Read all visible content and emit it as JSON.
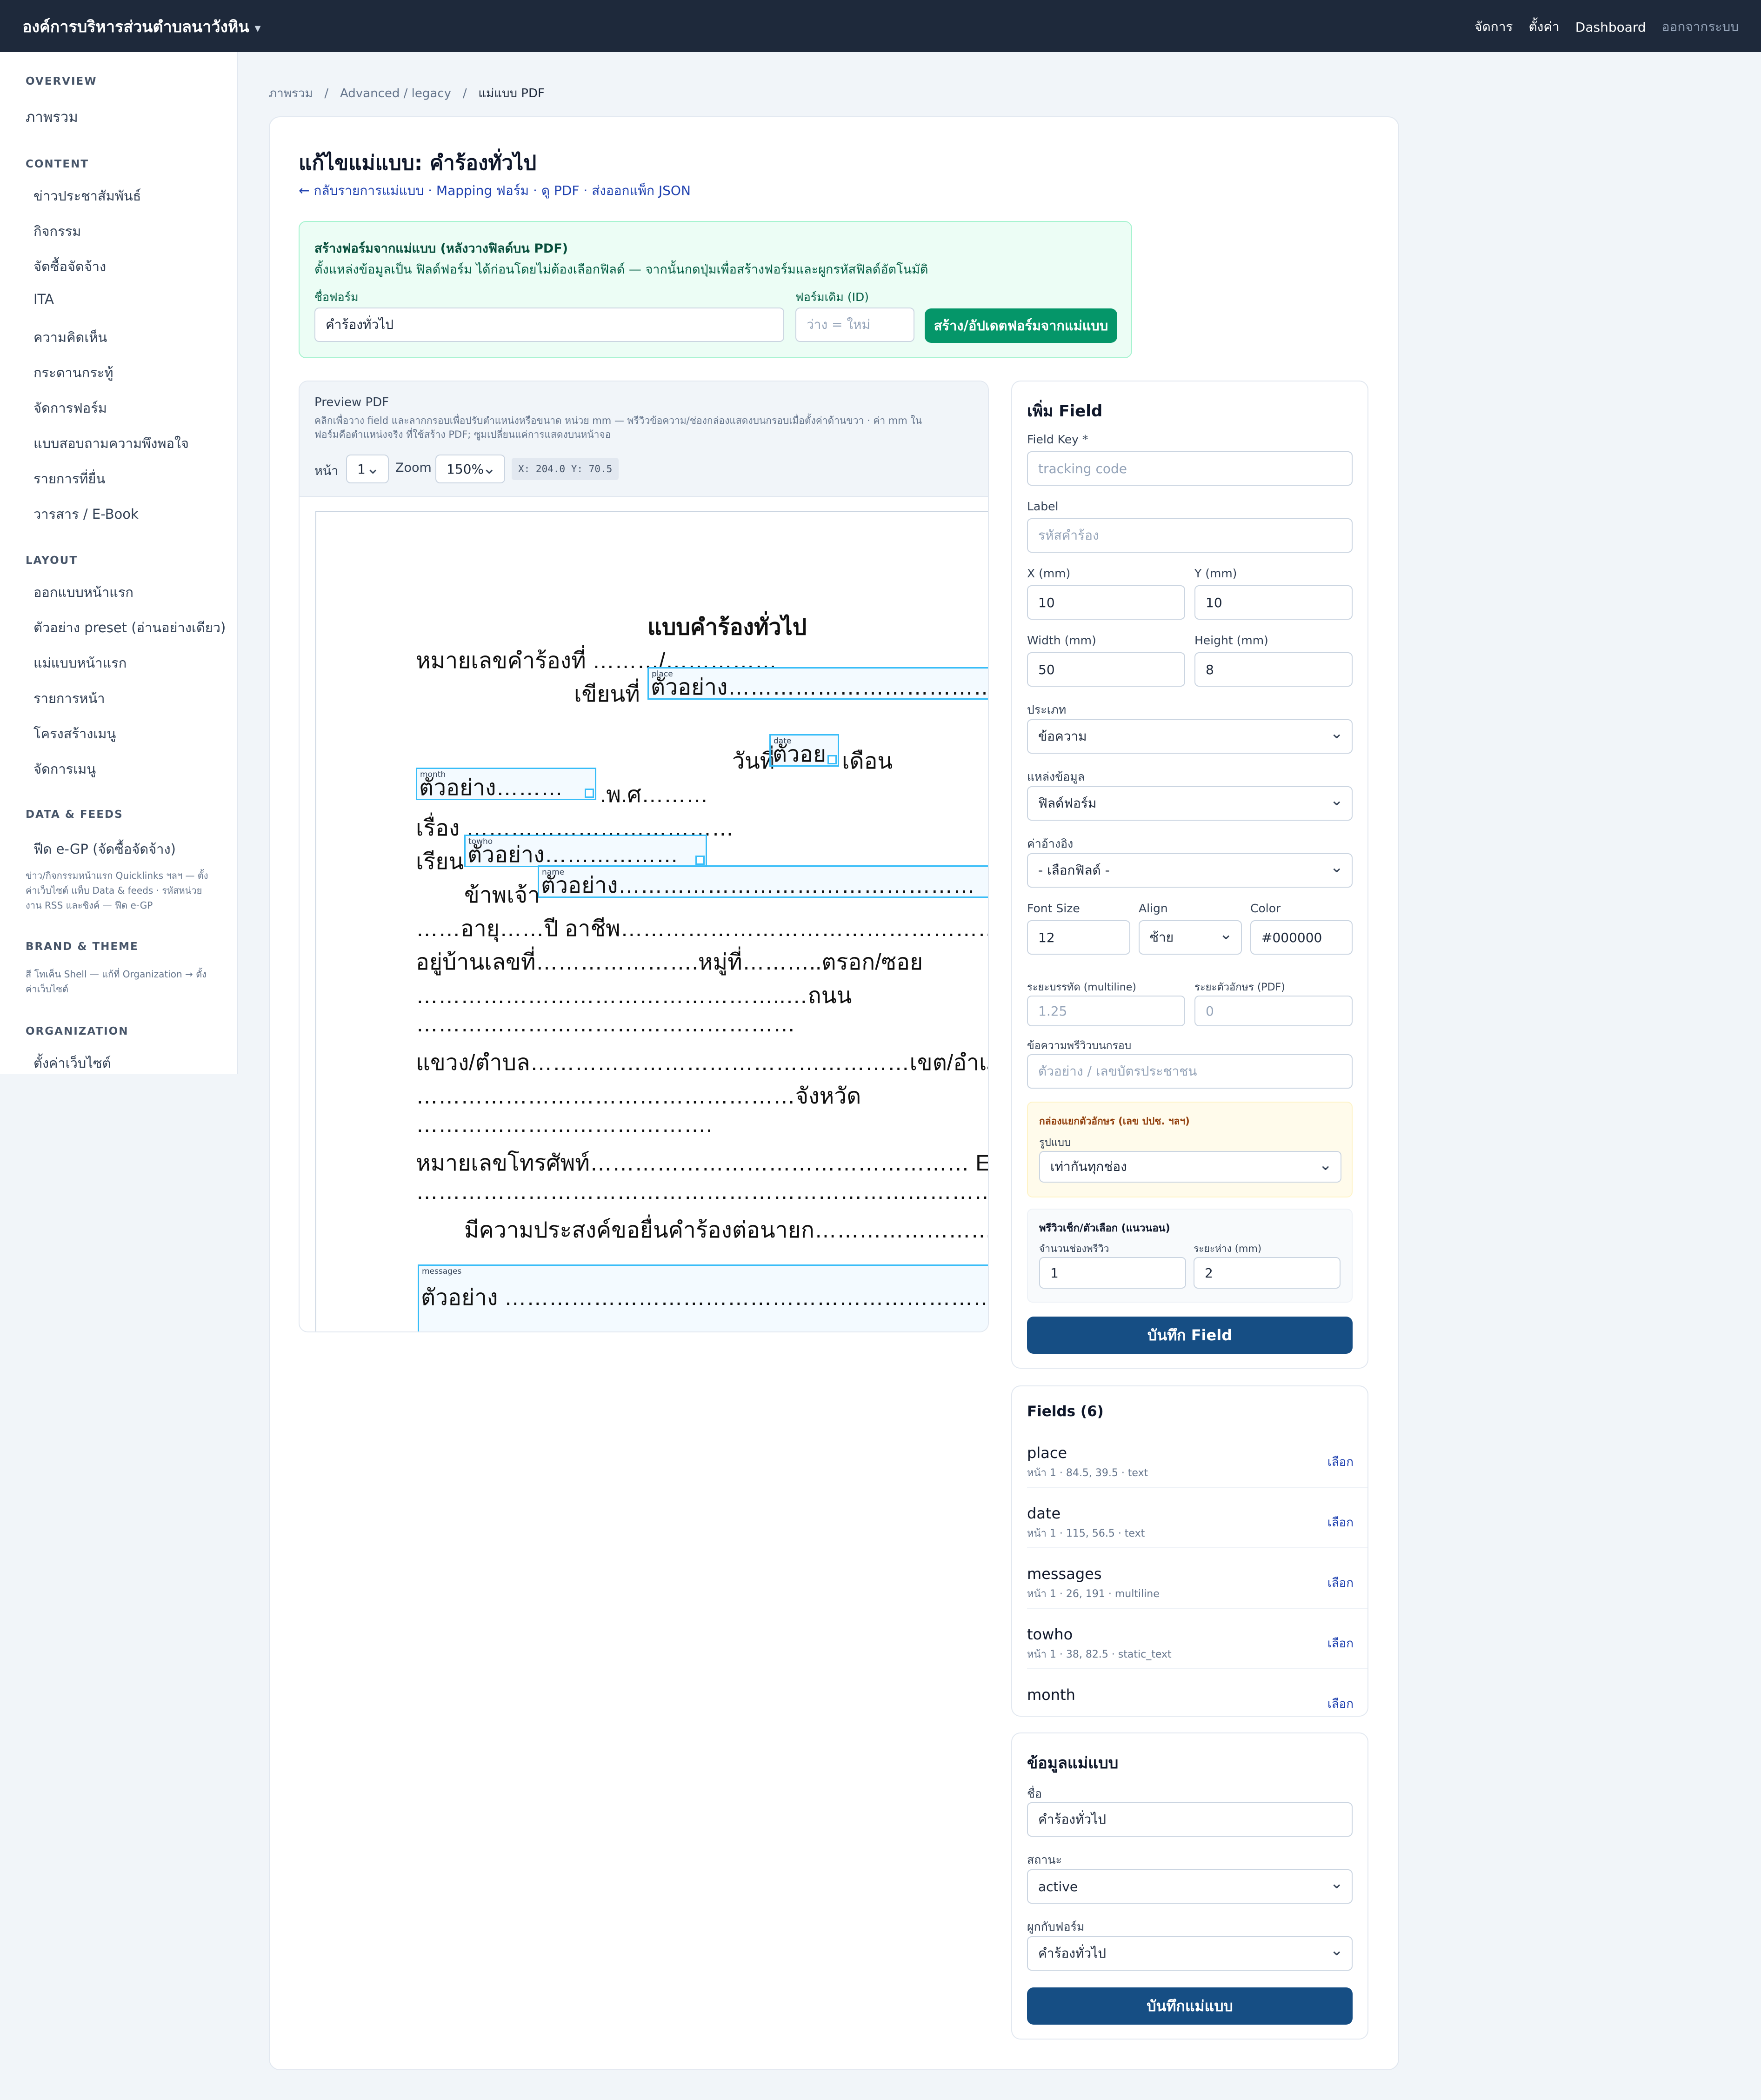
{
  "topbar": {
    "brand": "องค์การบริหารส่วนตำบลนาวังหิน",
    "brand_caret": "▾",
    "nav": [
      "จัดการ",
      "ตั้งค่า",
      "Dashboard"
    ],
    "logout": "ออกจากระบบ"
  },
  "sidebar": {
    "overview_title": "OVERVIEW",
    "overview_item": "ภาพรวม",
    "content_title": "CONTENT",
    "content_items": [
      "ข่าวประชาสัมพันธ์",
      "กิจกรรม",
      "จัดซื้อจัดจ้าง",
      "ITA",
      "ความคิดเห็น",
      "กระดานกระทู้",
      "จัดการฟอร์ม",
      "แบบสอบถามความพึงพอใจ",
      "รายการที่ยื่น",
      "วารสาร / E-Book"
    ],
    "layout_title": "LAYOUT",
    "layout_items": [
      "ออกแบบหน้าแรก",
      "ตัวอย่าง preset (อ่านอย่างเดียว)",
      "แม่แบบหน้าแรก",
      "รายการหน้า",
      "โครงสร้างเมนู",
      "จัดการเมนู"
    ],
    "data_title": "DATA & FEEDS",
    "data_item": "ฟีด e-GP (จัดซื้อจัดจ้าง)",
    "data_note": "ข่าว/กิจกรรมหน้าแรก Quicklinks ฯลฯ — ตั้งค่าเว็บไซต์ แท็บ Data & feeds · รหัสหน่วยงาน RSS และซิงค์ — ฟีด e-GP",
    "brand_title": "BRAND & THEME",
    "brand_note": "สี โทเค็น Shell — แก้ที่ Organization → ตั้งค่าเว็บไซต์",
    "org_title": "ORGANIZATION",
    "org_item": "ตั้งค่าเว็บไซต์"
  },
  "breadcrumb": [
    "ภาพรวม",
    "/",
    "Advanced / legacy",
    "/",
    "แม่แบบ PDF"
  ],
  "page_title": "แก้ไขแม่แบบ: คำร้องทั่วไป",
  "page_links": "← กลับรายการแม่แบบ · Mapping ฟอร์ม · ดู PDF · ส่งออกแพ็ก JSON",
  "create_form": {
    "title": "สร้างฟอร์มจากแม่แบบ (หลังวางฟิลด์บน PDF)",
    "desc": "ตั้งแหล่งข้อมูลเป็น ฟิลด์ฟอร์ม ได้ก่อนโดยไม่ต้องเลือกฟิลด์ — จากนั้นกดปุ่มเพื่อสร้างฟอร์มและผูกรหัสฟิลด์อัตโนมัติ",
    "name_label": "ชื่อฟอร์ม",
    "name_value": "คำร้องทั่วไป",
    "id_label": "ฟอร์มเดิม (ID)",
    "id_placeholder": "ว่าง = ใหม่",
    "button": "สร้าง/อัปเดตฟอร์มจากแม่แบบ"
  },
  "preview": {
    "title": "Preview PDF",
    "hint1": "คลิกเพื่อวาง field และลากกรอบเพื่อปรับตำแหน่งหรือขนาด หน่วย mm — พรีวิวข้อความ/ช่องกล่องแสดงบนกรอบเมื่อตั้งค่าด้านขวา · ค่า mm ใน",
    "hint2": "ฟอร์มคือตำแหน่งจริง ที่ใช้สร้าง PDF; ซูมเปลี่ยนแค่การแสดงบนหน้าจอ",
    "page_label": "หน้า",
    "page_value": "1",
    "zoom_label": "Zoom",
    "zoom_value": "150%",
    "coords": "X: 204.0  Y: 70.5"
  },
  "document": {
    "heading": "แบบคำร้องทั่วไป",
    "lines": [
      "หมายเลขคำร้องที่ ………/……………",
      "เขียนที่",
      "วันที่",
      "เดือน",
      ".พ.ศ………",
      "เรื่อง ………………………………",
      "เรียน",
      "ข้าพเจ้า",
      "……อายุ……ปี อาชีพ……………………………………………",
      "อยู่บ้านเลขที่………………….หมู่ที่………..ตรอก/ซอย",
      "…………………………………………..…ถนน",
      "……………………………………………",
      "แขวง/ตำบล……………………………………………เขต/อำเภอ",
      "……………………………………………จังหวัด",
      "………………………………….",
      "หมายเลขโทรศัพท์…………………………………………… E-Mail",
      "……………………………………………………………………………………",
      "มีความประสงค์ขอยื่นคำร้องต่อนายก……………………… ดั"
    ],
    "overlays": [
      {
        "name": "place",
        "sample": "ตัวอย่าง……………………………………………"
      },
      {
        "name": "date",
        "sample": "ตัวอย"
      },
      {
        "name": "month",
        "sample": "ตัวอย่าง………"
      },
      {
        "name": "towho",
        "sample": "ตัวอย่าง………………"
      },
      {
        "name": "name",
        "sample": "ตัวอย่าง…………………………………………"
      },
      {
        "name": "messages",
        "sample": "ตัวอย่าง ……………………………………………………………"
      }
    ]
  },
  "add_field": {
    "title": "เพิ่ม Field",
    "key_label": "Field Key *",
    "key_placeholder": "tracking code",
    "label_label": "Label",
    "label_placeholder": "รหัสคำร้อง",
    "x_label": "X (mm)",
    "x_value": "10",
    "y_label": "Y (mm)",
    "y_value": "10",
    "w_label": "Width (mm)",
    "w_value": "50",
    "h_label": "Height (mm)",
    "h_value": "8",
    "type_label": "ประเภท",
    "type_value": "ข้อความ",
    "source_label": "แหล่งข้อมูล",
    "source_value": "ฟิลด์ฟอร์ม",
    "ref_label": "ค่าอ้างอิง",
    "ref_value": "- เลือกฟิลด์ -",
    "font_label": "Font Size",
    "font_value": "12",
    "align_label": "Align",
    "align_value": "ซ้าย",
    "color_label": "Color",
    "color_value": "#000000",
    "lh_label": "ระยะบรรทัด (multiline)",
    "lh_placeholder": "1.25",
    "ls_label": "ระยะตัวอักษร (PDF)",
    "ls_placeholder": "0",
    "preview_label": "ข้อความพรีวิวบนกรอบ",
    "preview_placeholder": "ตัวอย่าง / เลขบัตรประชาชน",
    "split_title": "กล่องแยกตัวอักษร (เลข ปปช. ฯลฯ)",
    "split_label": "รูปแบบ",
    "split_value": "เท่ากันทุกช่อง",
    "check_title": "พรีวิวเช็ก/ตัวเลือก (แนวนอน)",
    "check_count_label": "จำนวนช่องพรีวิว",
    "check_count_value": "1",
    "check_gap_label": "ระยะห่าง (mm)",
    "check_gap_value": "2",
    "save_button": "บันทึก Field"
  },
  "fields_list": {
    "title": "Fields (6)",
    "select_label": "เลือก",
    "items": [
      {
        "key": "place",
        "meta": "หน้า 1 · 84.5, 39.5 · text"
      },
      {
        "key": "date",
        "meta": "หน้า 1 · 115, 56.5 · text"
      },
      {
        "key": "messages",
        "meta": "หน้า 1 · 26, 191 · multiline"
      },
      {
        "key": "towho",
        "meta": "หน้า 1 · 38, 82.5 · static_text"
      },
      {
        "key": "month",
        "meta": ""
      }
    ]
  },
  "template_info": {
    "title": "ข้อมูลแม่แบบ",
    "name_label": "ชื่อ",
    "name_value": "คำร้องทั่วไป",
    "status_label": "สถานะ",
    "status_value": "active",
    "form_label": "ผูกกับฟอร์ม",
    "form_value": "คำร้องทั่วไป",
    "save_button": "บันทึกแม่แบบ"
  },
  "colors": {
    "topbar": "#1e293b",
    "primary": "#164e84",
    "green_button": "#059669",
    "link": "#1e40af",
    "overlay_border": "#38bdf8"
  }
}
